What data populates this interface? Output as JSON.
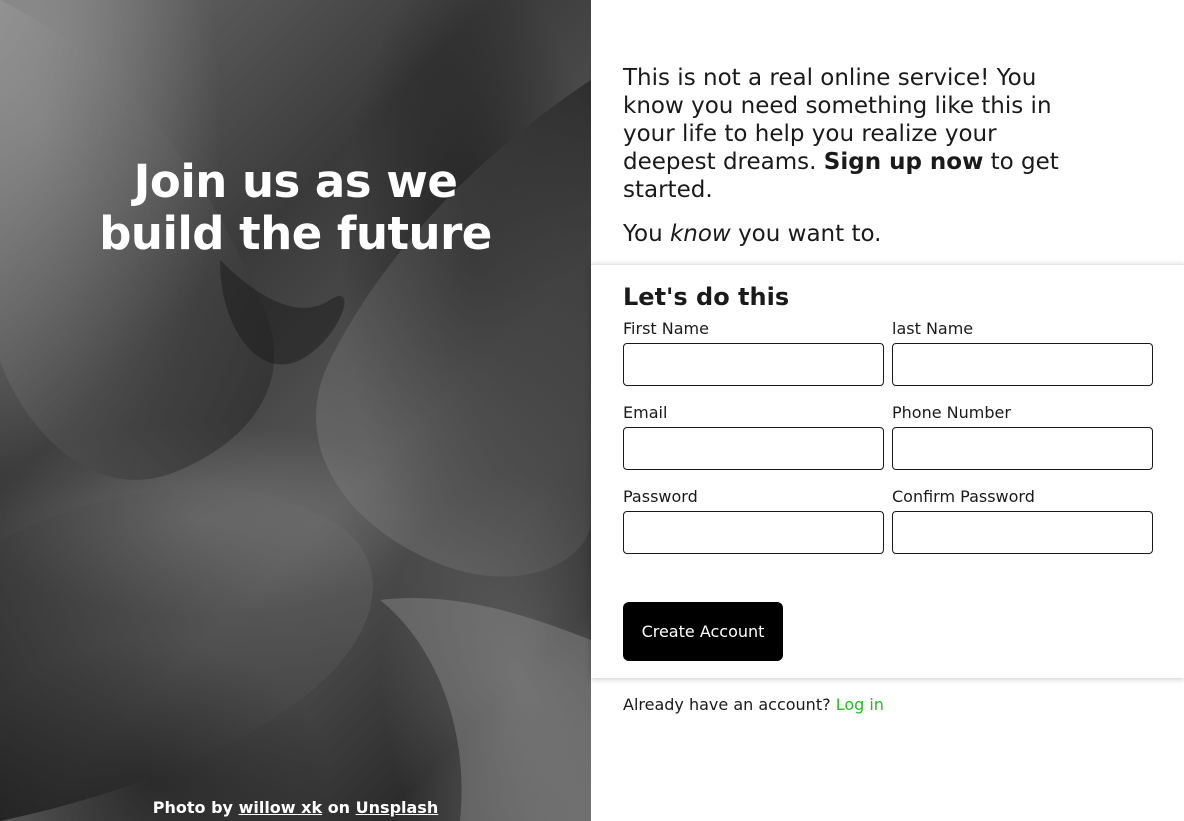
{
  "hero": {
    "title_line1": "Join us as we",
    "title_line2": "build the future",
    "credit_prefix": "Photo by",
    "credit_author": "willow xk",
    "credit_mid": "on",
    "credit_source": "Unsplash"
  },
  "intro": {
    "text_part1": "This is not a real online service! You know you need something like this in your life to help you realize your deepest dreams.",
    "text_bold": "Sign up now",
    "text_part2": "to get started.",
    "line2_prefix": "You",
    "line2_em": "know",
    "line2_suffix": "you want to."
  },
  "form": {
    "title": "Let's do this",
    "fields": [
      {
        "label": "First Name",
        "value": ""
      },
      {
        "label": "last Name",
        "value": ""
      },
      {
        "label": "Email",
        "value": ""
      },
      {
        "label": "Phone Number",
        "value": ""
      },
      {
        "label": "Password",
        "value": ""
      },
      {
        "label": "Confirm Password",
        "value": ""
      }
    ],
    "submit_label": "Create Account"
  },
  "footer": {
    "question": "Already have an account?",
    "login_label": "Log in"
  },
  "colors": {
    "accent": "#1fbf1f",
    "button": "#000000"
  }
}
